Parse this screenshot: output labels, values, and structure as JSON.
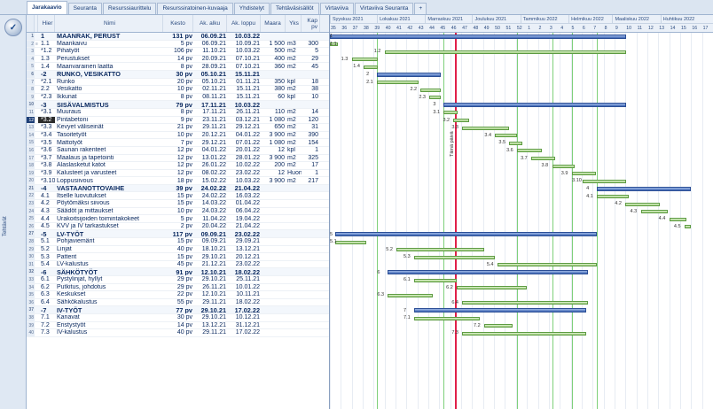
{
  "tabs": [
    "Jarakaavio",
    "Seuranta",
    "Resurssiaurittelu",
    "Resurssiratoinen-kuvaaja",
    "Yhdistelyt",
    "Tehtäväsisällöt",
    "Virtaviiva",
    "Virtaviiva Seuranta",
    "+"
  ],
  "active_tab": 0,
  "side_label": "Tehtävät",
  "columns": [
    "",
    "",
    "Hier",
    "Nimi",
    "Kesto",
    "Ak. alku",
    "Ak. loppu",
    "Maara",
    "Yks",
    "Kap pv"
  ],
  "gantt": {
    "months": [
      "Syyskuu 2021",
      "Lokakuu 2021",
      "Marraskuu 2021",
      "Joulukuu 2021",
      "Tammikuu 2022",
      "Helmikuu 2022",
      "Maaliskuu 2022",
      "Huhtikuu 2022"
    ],
    "weeks": [
      "35",
      "36",
      "37",
      "38",
      "39",
      "40",
      "41",
      "42",
      "43",
      "44",
      "45",
      "46",
      "47",
      "48",
      "49",
      "50",
      "51",
      "52",
      "1",
      "2",
      "3",
      "4",
      "5",
      "6",
      "7",
      "8",
      "9",
      "10",
      "11",
      "12",
      "13",
      "14",
      "15",
      "16",
      "17"
    ],
    "today_label": "Tämä päivä"
  },
  "rows": [
    {
      "rn": "1",
      "mk": "",
      "id": "1",
      "name": "MAANRAK, PERUST",
      "dur": "131 pv",
      "start": "06.09.21",
      "end": "10.03.22",
      "qty": "",
      "unit": "",
      "cap": "",
      "sum": true,
      "bar": {
        "type": "sum",
        "s": 0,
        "e": 27.1
      },
      "label": "1"
    },
    {
      "rn": "2",
      "mk": "≡",
      "id": "1.1",
      "name": "Maankaivu",
      "dur": "5 pv",
      "start": "06.09.21",
      "end": "10.09.21",
      "qty": "1 500",
      "unit": "m3",
      "cap": "300",
      "sum": false,
      "bar": {
        "type": "task",
        "s": 0,
        "e": 0.7
      },
      "label": "1.1"
    },
    {
      "rn": "3",
      "mk": "",
      "id": "*1.2",
      "name": "Pihatyöt",
      "dur": "106 pv",
      "start": "11.10.21",
      "end": "10.03.22",
      "qty": "500",
      "unit": "m2",
      "cap": "5",
      "sum": false,
      "bar": {
        "type": "task",
        "s": 5.0,
        "e": 27.1
      },
      "label": "1.2"
    },
    {
      "rn": "4",
      "mk": "",
      "id": "1.3",
      "name": "Perustukset",
      "dur": "14 pv",
      "start": "20.09.21",
      "end": "07.10.21",
      "qty": "400",
      "unit": "m2",
      "cap": "29",
      "sum": false,
      "bar": {
        "type": "task",
        "s": 2.0,
        "e": 4.4
      },
      "label": "1.3"
    },
    {
      "rn": "5",
      "mk": "",
      "id": "1.4",
      "name": "Maanvarainen laatta",
      "dur": "8 pv",
      "start": "28.09.21",
      "end": "07.10.21",
      "qty": "360",
      "unit": "m2",
      "cap": "45",
      "sum": false,
      "bar": {
        "type": "task",
        "s": 3.1,
        "e": 4.4
      },
      "label": "1.4"
    },
    {
      "rn": "6",
      "mk": "",
      "id": "-2",
      "name": "RUNKO, VESIKATTO",
      "dur": "30 pv",
      "start": "05.10.21",
      "end": "15.11.21",
      "qty": "",
      "unit": "",
      "cap": "",
      "sum": true,
      "bar": {
        "type": "sum",
        "s": 4.3,
        "e": 10.1
      },
      "label": "2"
    },
    {
      "rn": "7",
      "mk": "",
      "id": "*2.1",
      "name": "Runko",
      "dur": "20 pv",
      "start": "05.10.21",
      "end": "01.11.21",
      "qty": "350",
      "unit": "kpl",
      "cap": "18",
      "sum": false,
      "bar": {
        "type": "task",
        "s": 4.3,
        "e": 8.1
      },
      "label": "2.1"
    },
    {
      "rn": "8",
      "mk": "",
      "id": "2.2",
      "name": "Vesikatto",
      "dur": "10 pv",
      "start": "02.11.21",
      "end": "15.11.21",
      "qty": "380",
      "unit": "m2",
      "cap": "38",
      "sum": false,
      "bar": {
        "type": "task",
        "s": 8.3,
        "e": 10.1
      },
      "label": "2.2"
    },
    {
      "rn": "9",
      "mk": "",
      "id": "*2.3",
      "name": "Ikkunat",
      "dur": "8 pv",
      "start": "08.11.21",
      "end": "15.11.21",
      "qty": "60",
      "unit": "kpl",
      "cap": "10",
      "sum": false,
      "bar": {
        "type": "task",
        "s": 9.1,
        "e": 10.1
      },
      "label": "2.3"
    },
    {
      "rn": "10",
      "mk": "",
      "id": "-3",
      "name": "SISÄVALMISTUS",
      "dur": "79 pv",
      "start": "17.11.21",
      "end": "10.03.22",
      "qty": "",
      "unit": "",
      "cap": "",
      "sum": true,
      "bar": {
        "type": "sum",
        "s": 10.4,
        "e": 27.1
      },
      "label": "3"
    },
    {
      "rn": "11",
      "mk": "",
      "id": "*3.1",
      "name": "Muuraus",
      "dur": "8 pv",
      "start": "17.11.21",
      "end": "26.11.21",
      "qty": "110",
      "unit": "m2",
      "cap": "14",
      "sum": false,
      "bar": {
        "type": "task",
        "s": 10.4,
        "e": 11.7
      },
      "label": "3.1"
    },
    {
      "rn": "12",
      "mk": "",
      "id": "*3.2",
      "name": "Pintabetoni",
      "dur": "9 pv",
      "start": "23.11.21",
      "end": "03.12.21",
      "qty": "1 080",
      "unit": "m2",
      "cap": "120",
      "sum": false,
      "sel": true,
      "bar": {
        "type": "task",
        "s": 11.3,
        "e": 12.7
      },
      "label": "3.2"
    },
    {
      "rn": "13",
      "mk": "",
      "id": "*3.3",
      "name": "Kevyet väliseinät",
      "dur": "21 pv",
      "start": "29.11.21",
      "end": "29.12.21",
      "qty": "650",
      "unit": "m2",
      "cap": "31",
      "sum": false,
      "bar": {
        "type": "task",
        "s": 12.1,
        "e": 16.4
      },
      "label": "3.3"
    },
    {
      "rn": "14",
      "mk": "",
      "id": "*3.4",
      "name": "Tasoitetyöt",
      "dur": "10 pv",
      "start": "20.12.21",
      "end": "04.01.22",
      "qty": "3 900",
      "unit": "m2",
      "cap": "390",
      "sum": false,
      "bar": {
        "type": "task",
        "s": 15.1,
        "e": 17.1
      },
      "label": "3.4"
    },
    {
      "rn": "15",
      "mk": "",
      "id": "*3.5",
      "name": "Mattotyöt",
      "dur": "7 pv",
      "start": "29.12.21",
      "end": "07.01.22",
      "qty": "1 080",
      "unit": "m2",
      "cap": "154",
      "sum": false,
      "bar": {
        "type": "task",
        "s": 16.4,
        "e": 17.6
      },
      "label": "3.5"
    },
    {
      "rn": "16",
      "mk": "",
      "id": "*3.6",
      "name": "Saunan rakenteet",
      "dur": "12 pv",
      "start": "04.01.22",
      "end": "20.01.22",
      "qty": "12",
      "unit": "kpl",
      "cap": "1",
      "sum": false,
      "bar": {
        "type": "task",
        "s": 17.1,
        "e": 19.4
      },
      "label": "3.6"
    },
    {
      "rn": "17",
      "mk": "",
      "id": "*3.7",
      "name": "Maalaus ja tapetointi",
      "dur": "12 pv",
      "start": "13.01.22",
      "end": "28.01.22",
      "qty": "3 900",
      "unit": "m2",
      "cap": "325",
      "sum": false,
      "bar": {
        "type": "task",
        "s": 18.4,
        "e": 20.6
      },
      "label": "3.7"
    },
    {
      "rn": "18",
      "mk": "",
      "id": "*3.8",
      "name": "Alaslasketut katot",
      "dur": "12 pv",
      "start": "26.01.22",
      "end": "10.02.22",
      "qty": "200",
      "unit": "m2",
      "cap": "17",
      "sum": false,
      "bar": {
        "type": "task",
        "s": 20.3,
        "e": 22.4
      },
      "label": "3.8"
    },
    {
      "rn": "19",
      "mk": "",
      "id": "*3.9",
      "name": "Kalusteet ja varusteet",
      "dur": "12 pv",
      "start": "08.02.22",
      "end": "23.02.22",
      "qty": "12",
      "unit": "Huon",
      "cap": "1",
      "sum": false,
      "bar": {
        "type": "task",
        "s": 22.1,
        "e": 24.3
      },
      "label": "3.9"
    },
    {
      "rn": "20",
      "mk": "",
      "id": "*3.10",
      "name": "Loppusiivous",
      "dur": "18 pv",
      "start": "15.02.22",
      "end": "10.03.22",
      "qty": "3 900",
      "unit": "m2",
      "cap": "217",
      "sum": false,
      "bar": {
        "type": "task",
        "s": 23.1,
        "e": 27.1
      },
      "label": "3.10"
    },
    {
      "rn": "21",
      "mk": "",
      "id": "-4",
      "name": "VASTAANOTTOVAIHE",
      "dur": "39 pv",
      "start": "24.02.22",
      "end": "21.04.22",
      "qty": "",
      "unit": "",
      "cap": "",
      "sum": true,
      "bar": {
        "type": "sum",
        "s": 24.4,
        "e": 33.0
      },
      "label": "4"
    },
    {
      "rn": "22",
      "mk": "",
      "id": "4.1",
      "name": "Itselle luovutukset",
      "dur": "15 pv",
      "start": "24.02.22",
      "end": "16.03.22",
      "qty": "",
      "unit": "",
      "cap": "",
      "sum": false,
      "bar": {
        "type": "task",
        "s": 24.4,
        "e": 27.3
      },
      "label": "4.1"
    },
    {
      "rn": "23",
      "mk": "",
      "id": "4.2",
      "name": "Pöytömäksi siivous",
      "dur": "15 pv",
      "start": "14.03.22",
      "end": "01.04.22",
      "qty": "",
      "unit": "",
      "cap": "",
      "sum": false,
      "bar": {
        "type": "task",
        "s": 27.0,
        "e": 30.1
      },
      "label": "4.2"
    },
    {
      "rn": "24",
      "mk": "",
      "id": "4.3",
      "name": "Säädöt ja mittaukset",
      "dur": "10 pv",
      "start": "24.03.22",
      "end": "06.04.22",
      "qty": "",
      "unit": "",
      "cap": "",
      "sum": false,
      "bar": {
        "type": "task",
        "s": 28.4,
        "e": 30.9
      },
      "label": "4.3"
    },
    {
      "rn": "25",
      "mk": "",
      "id": "4.4",
      "name": "Urakoitsijoiden toimintakokeet",
      "dur": "5 pv",
      "start": "11.04.22",
      "end": "19.04.22",
      "qty": "",
      "unit": "",
      "cap": "",
      "sum": false,
      "bar": {
        "type": "task",
        "s": 31.0,
        "e": 32.6
      },
      "label": "4.4"
    },
    {
      "rn": "26",
      "mk": "",
      "id": "4.5",
      "name": "KVV ja IV tarkastukset",
      "dur": "2 pv",
      "start": "20.04.22",
      "end": "21.04.22",
      "qty": "",
      "unit": "",
      "cap": "",
      "sum": false,
      "bar": {
        "type": "task",
        "s": 32.4,
        "e": 33.0
      },
      "label": "4.5"
    },
    {
      "rn": "27",
      "mk": "",
      "id": "-5",
      "name": "LV-TYÖT",
      "dur": "117 pv",
      "start": "09.09.21",
      "end": "23.02.22",
      "qty": "",
      "unit": "",
      "cap": "",
      "sum": true,
      "bar": {
        "type": "sum",
        "s": 0.5,
        "e": 24.4
      },
      "label": "5"
    },
    {
      "rn": "28",
      "mk": "",
      "id": "5.1",
      "name": "Pohjaviemärit",
      "dur": "15 pv",
      "start": "09.09.21",
      "end": "29.09.21",
      "qty": "",
      "unit": "",
      "cap": "",
      "sum": false,
      "bar": {
        "type": "task",
        "s": 0.5,
        "e": 3.3
      },
      "label": "5.1"
    },
    {
      "rn": "29",
      "mk": "",
      "id": "5.2",
      "name": "Linjat",
      "dur": "40 pv",
      "start": "18.10.21",
      "end": "13.12.21",
      "qty": "",
      "unit": "",
      "cap": "",
      "sum": false,
      "bar": {
        "type": "task",
        "s": 6.1,
        "e": 14.1
      },
      "label": "5.2"
    },
    {
      "rn": "30",
      "mk": "",
      "id": "5.3",
      "name": "Patterit",
      "dur": "15 pv",
      "start": "29.10.21",
      "end": "20.12.21",
      "qty": "",
      "unit": "",
      "cap": "",
      "sum": false,
      "bar": {
        "type": "task",
        "s": 7.7,
        "e": 15.1
      },
      "label": "5.3"
    },
    {
      "rn": "31",
      "mk": "",
      "id": "5.4",
      "name": "LV-kalustus",
      "dur": "45 pv",
      "start": "21.12.21",
      "end": "23.02.22",
      "qty": "",
      "unit": "",
      "cap": "",
      "sum": false,
      "bar": {
        "type": "task",
        "s": 15.3,
        "e": 24.4
      },
      "label": "5.4"
    },
    {
      "rn": "32",
      "mk": "",
      "id": "-6",
      "name": "SÄHKÖTYÖT",
      "dur": "91 pv",
      "start": "12.10.21",
      "end": "18.02.22",
      "qty": "",
      "unit": "",
      "cap": "",
      "sum": true,
      "bar": {
        "type": "sum",
        "s": 5.3,
        "e": 23.6
      },
      "label": "6"
    },
    {
      "rn": "33",
      "mk": "",
      "id": "6.1",
      "name": "Pystylinjat, hyllyt",
      "dur": "29 pv",
      "start": "29.10.21",
      "end": "25.11.21",
      "qty": "",
      "unit": "",
      "cap": "",
      "sum": false,
      "bar": {
        "type": "task",
        "s": 7.7,
        "e": 11.6
      },
      "label": "6.1"
    },
    {
      "rn": "34",
      "mk": "",
      "id": "6.2",
      "name": "Putkitus, johdotus",
      "dur": "29 pv",
      "start": "26.11.21",
      "end": "10.01.22",
      "qty": "",
      "unit": "",
      "cap": "",
      "sum": false,
      "bar": {
        "type": "task",
        "s": 11.6,
        "e": 18.0
      },
      "label": "6.2"
    },
    {
      "rn": "35",
      "mk": "",
      "id": "6.3",
      "name": "Keskukset",
      "dur": "22 pv",
      "start": "12.10.21",
      "end": "10.11.21",
      "qty": "",
      "unit": "",
      "cap": "",
      "sum": false,
      "bar": {
        "type": "task",
        "s": 5.3,
        "e": 9.4
      },
      "label": "6.3"
    },
    {
      "rn": "36",
      "mk": "",
      "id": "6.4",
      "name": "Sähkökalustus",
      "dur": "55 pv",
      "start": "29.11.21",
      "end": "18.02.22",
      "qty": "",
      "unit": "",
      "cap": "",
      "sum": false,
      "bar": {
        "type": "task",
        "s": 12.1,
        "e": 23.6
      },
      "label": "6.4"
    },
    {
      "rn": "37",
      "mk": "",
      "id": "-7",
      "name": "IV-TYÖT",
      "dur": "77 pv",
      "start": "29.10.21",
      "end": "17.02.22",
      "qty": "",
      "unit": "",
      "cap": "",
      "sum": true,
      "bar": {
        "type": "sum",
        "s": 7.7,
        "e": 23.4
      },
      "label": "7"
    },
    {
      "rn": "38",
      "mk": "",
      "id": "7.1",
      "name": "Kanavat",
      "dur": "30 pv",
      "start": "29.10.21",
      "end": "10.12.21",
      "qty": "",
      "unit": "",
      "cap": "",
      "sum": false,
      "bar": {
        "type": "task",
        "s": 7.7,
        "e": 13.7
      },
      "label": "7.1"
    },
    {
      "rn": "39",
      "mk": "",
      "id": "7.2",
      "name": "Eristystyöt",
      "dur": "14 pv",
      "start": "13.12.21",
      "end": "31.12.21",
      "qty": "",
      "unit": "",
      "cap": "",
      "sum": false,
      "bar": {
        "type": "task",
        "s": 14.1,
        "e": 16.7
      },
      "label": "7.2"
    },
    {
      "rn": "40",
      "mk": "",
      "id": "7.3",
      "name": "IV-kalustus",
      "dur": "40 pv",
      "start": "29.11.21",
      "end": "17.02.22",
      "qty": "",
      "unit": "",
      "cap": "",
      "sum": false,
      "bar": {
        "type": "task",
        "s": 12.1,
        "e": 23.4
      },
      "label": "7.3"
    }
  ],
  "today_week_index": 11.4,
  "green_week_lines": [
    4.3,
    10.4,
    17.1,
    20.3,
    22.1,
    24.4
  ]
}
